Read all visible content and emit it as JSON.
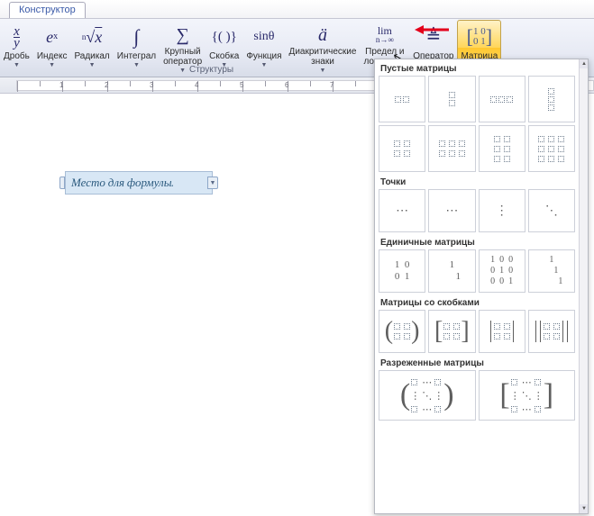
{
  "tab": {
    "label": "Конструктор"
  },
  "ribbon": {
    "group_label": "Структуры",
    "buttons": [
      {
        "glyph": "x/y",
        "label1": "Дробь",
        "label2": ""
      },
      {
        "glyph": "eˣ",
        "label1": "Индекс",
        "label2": ""
      },
      {
        "glyph": "ⁿ√x",
        "label1": "Радикал",
        "label2": ""
      },
      {
        "glyph": "∫₋ₓ",
        "label1": "Интеграл",
        "label2": ""
      },
      {
        "glyph": "∑",
        "label1": "Крупный",
        "label2": "оператор"
      },
      {
        "glyph": "{()}",
        "label1": "Скобка",
        "label2": ""
      },
      {
        "glyph": "sinθ",
        "label1": "Функция",
        "label2": ""
      },
      {
        "glyph": "ä",
        "label1": "Диакритические",
        "label2": "знаки"
      },
      {
        "glyph": "lim",
        "label1": "Предел и",
        "label2": "логарифм"
      },
      {
        "glyph": "≜",
        "label1": "Оператор",
        "label2": ""
      },
      {
        "glyph": "[10;01]",
        "label1": "Матрица",
        "label2": ""
      }
    ]
  },
  "eq_placeholder": "Место для формулы.",
  "gallery": {
    "sections": {
      "empty": "Пустые матрицы",
      "dots": "Точки",
      "identity": "Единичные матрицы",
      "brackets": "Матрицы со скобками",
      "sparse": "Разреженные матрицы"
    },
    "identity_items": [
      "1  0\n0  1",
      "1\n     1",
      "1  0  0\n0  1  0\n0  0  1",
      "1\n    1\n        1"
    ]
  }
}
